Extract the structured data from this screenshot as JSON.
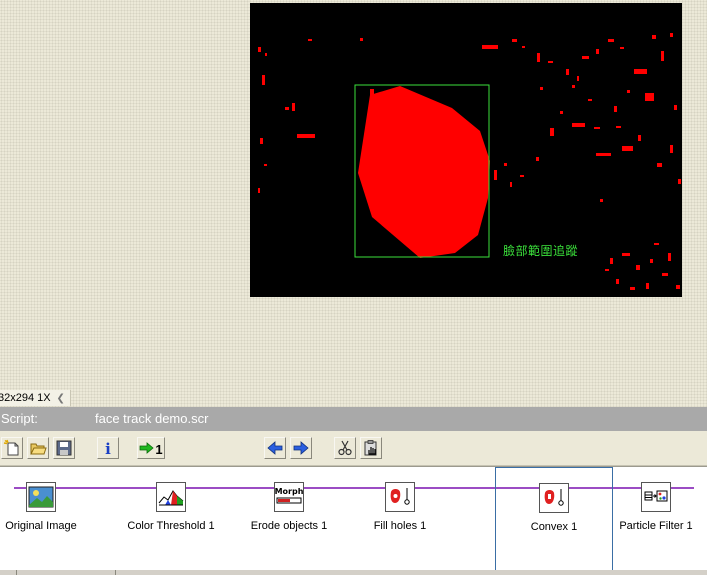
{
  "viewer": {
    "overlay_label": "臉部範圍追蹤",
    "colors": {
      "background": "#000000",
      "blob": "#ff0000",
      "box": "#3be13b"
    }
  },
  "status": {
    "image_size": "32x294 1X",
    "scroll_icon": "chevron-left-icon"
  },
  "script_bar": {
    "label": "Script:",
    "filename": "face track demo.scr"
  },
  "toolbar": {
    "buttons": [
      {
        "name": "new-script-button",
        "icon": "new-document-icon"
      },
      {
        "name": "open-script-button",
        "icon": "folder-open-icon"
      },
      {
        "name": "save-script-button",
        "icon": "floppy-disk-icon"
      },
      {
        "name": "info-button",
        "icon": "info-icon",
        "glyph": "i"
      },
      {
        "name": "run-once-button",
        "icon": "run-arrow-icon",
        "glyph": "1"
      },
      {
        "name": "step-back-button",
        "icon": "arrow-left-icon"
      },
      {
        "name": "step-forward-button",
        "icon": "arrow-right-icon"
      },
      {
        "name": "cut-step-button",
        "icon": "scissors-icon"
      },
      {
        "name": "step-properties-button",
        "icon": "clipboard-hand-icon"
      }
    ]
  },
  "steps": [
    {
      "label": "Original Image",
      "icon": "landscape-image-icon"
    },
    {
      "label": "Color Threshold 1",
      "icon": "histogram-icon"
    },
    {
      "label": "Erode objects 1",
      "icon": "morph-icon",
      "icon_text": "Morph"
    },
    {
      "label": "Fill holes 1",
      "icon": "fill-holes-icon"
    },
    {
      "label": "Convex 1",
      "icon": "convex-icon",
      "selected": true
    },
    {
      "label": "Particle Filter 1",
      "icon": "particle-filter-icon"
    }
  ]
}
